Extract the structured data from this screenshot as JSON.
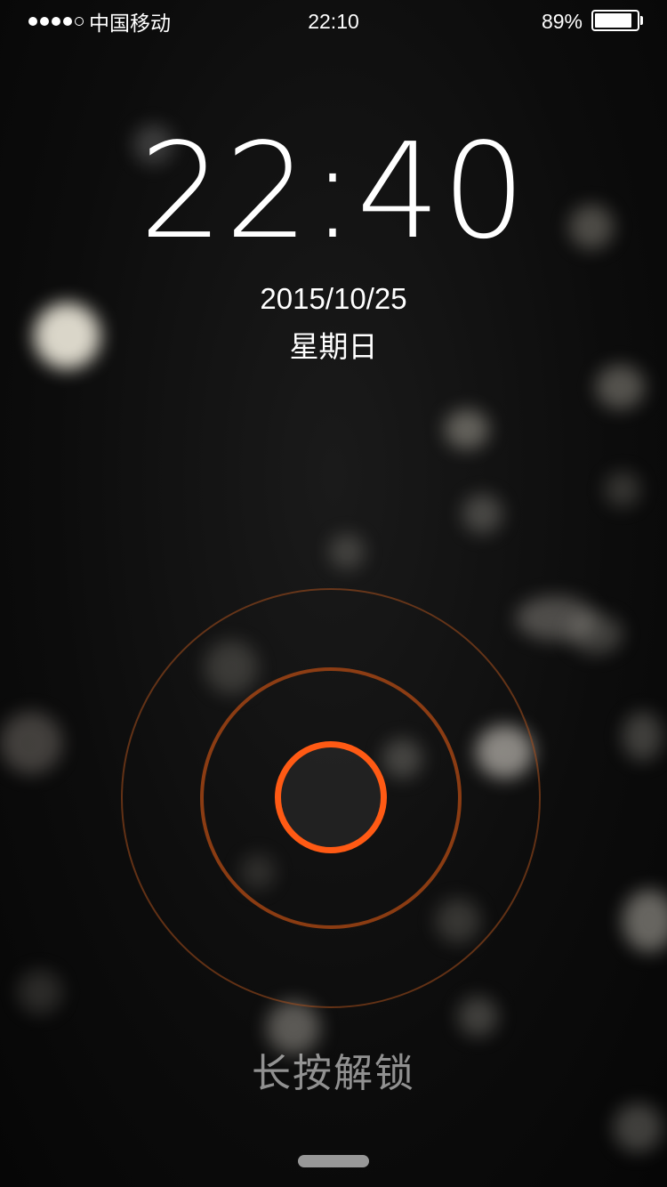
{
  "status_bar": {
    "carrier": "中国移动",
    "time": "22:10",
    "battery_percent": "89%",
    "battery_level": 0.89,
    "signal_strength": 4,
    "signal_max": 5
  },
  "lock_screen": {
    "clock": "22:40",
    "date": "2015/10/25",
    "weekday": "星期日",
    "unlock_hint": "长按解锁"
  },
  "colors": {
    "accent": "#ff5a14",
    "ring": "#b44b14"
  }
}
